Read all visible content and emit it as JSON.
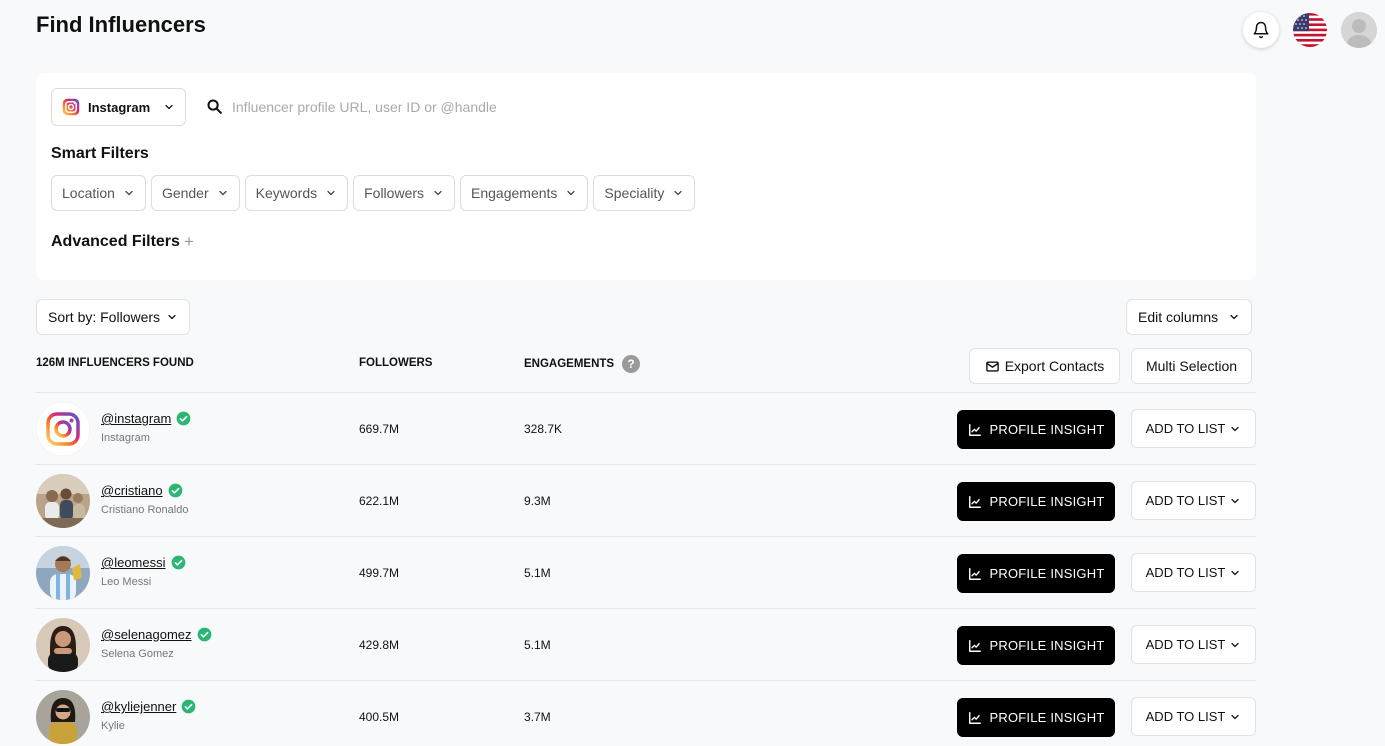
{
  "header": {
    "title": "Find Influencers"
  },
  "search": {
    "platform": "Instagram",
    "placeholder": "Influencer profile URL, user ID or @handle",
    "value": ""
  },
  "smart_filters": {
    "title": "Smart Filters",
    "items": [
      "Location",
      "Gender",
      "Keywords",
      "Followers",
      "Engagements",
      "Speciality"
    ]
  },
  "advanced_filters": {
    "title": "Advanced Filters",
    "icon": "plus-icon"
  },
  "sort": {
    "label": "Sort by: Followers"
  },
  "edit_columns": {
    "label": "Edit columns"
  },
  "table": {
    "headers": {
      "count": "126M INFLUENCERS FOUND",
      "followers": "FOLLOWERS",
      "engagements": "ENGAGEMENTS",
      "help": "?"
    },
    "export_label": "Export Contacts",
    "multi_label": "Multi Selection",
    "profile_insight_label": "PROFILE INSIGHT",
    "add_to_list_label": "ADD TO LIST",
    "rows": [
      {
        "handle": "@instagram",
        "name": "Instagram",
        "followers": "669.7M",
        "engagements": "328.7K"
      },
      {
        "handle": "@cristiano",
        "name": "Cristiano Ronaldo",
        "followers": "622.1M",
        "engagements": "9.3M"
      },
      {
        "handle": "@leomessi",
        "name": "Leo Messi",
        "followers": "499.7M",
        "engagements": "5.1M"
      },
      {
        "handle": "@selenagomez",
        "name": "Selena Gomez",
        "followers": "429.8M",
        "engagements": "5.1M"
      },
      {
        "handle": "@kyliejenner",
        "name": "Kylie",
        "followers": "400.5M",
        "engagements": "3.7M"
      }
    ]
  },
  "colors": {
    "verified": "#2bb673",
    "primary_button": "#000000",
    "background": "#f8f9fa"
  }
}
